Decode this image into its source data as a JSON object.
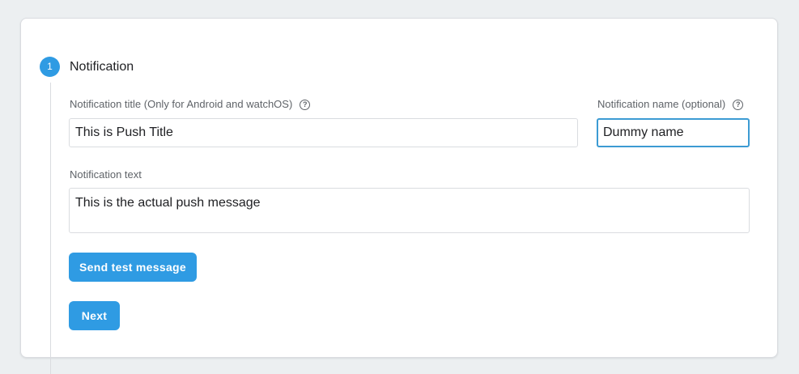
{
  "step": {
    "number": "1",
    "title": "Notification"
  },
  "fields": {
    "title": {
      "label": "Notification title (Only for Android and watchOS)",
      "value": "This is Push Title"
    },
    "name": {
      "label": "Notification name (optional)",
      "value": "Dummy name"
    },
    "text": {
      "label": "Notification text",
      "value": "This is the actual push message"
    }
  },
  "buttons": {
    "send_test": "Send test message",
    "next": "Next"
  },
  "icons": {
    "help": "question-mark-circle-icon"
  },
  "colors": {
    "accent": "#2f9be3",
    "focus_border": "#3c9bd3",
    "background": "#eceff1"
  }
}
